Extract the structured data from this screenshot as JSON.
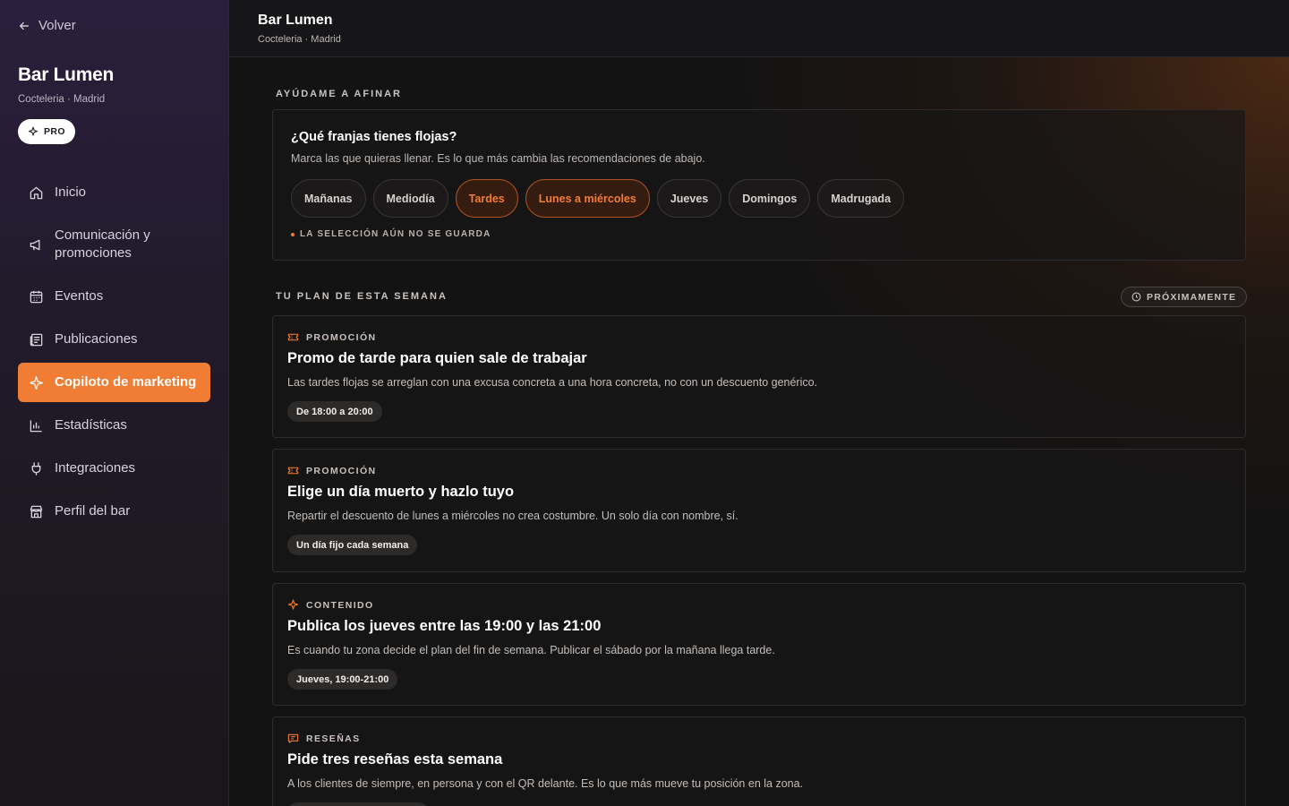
{
  "sidebar": {
    "back_label": "Volver",
    "bar_name": "Bar Lumen",
    "bar_subtitle": "Cocteleria · Madrid",
    "badge": "PRO",
    "items": [
      {
        "label": "Inicio",
        "icon": "home-icon"
      },
      {
        "label": "Comunicación y promociones",
        "icon": "megaphone-icon"
      },
      {
        "label": "Eventos",
        "icon": "calendar-icon"
      },
      {
        "label": "Publicaciones",
        "icon": "newspaper-icon"
      },
      {
        "label": "Copiloto de marketing",
        "icon": "sparkle-icon",
        "active": true
      },
      {
        "label": "Estadísticas",
        "icon": "bar-chart-icon"
      },
      {
        "label": "Integraciones",
        "icon": "plug-icon"
      },
      {
        "label": "Perfil del bar",
        "icon": "store-icon"
      }
    ]
  },
  "header": {
    "title": "Bar Lumen",
    "subtitle": "Cocteleria · Madrid"
  },
  "tune": {
    "section_label": "AYÚDAME A AFINAR",
    "question": "¿Qué franjas tienes flojas?",
    "description": "Marca las que quieras llenar. Es lo que más cambia las recomendaciones de abajo.",
    "chips": [
      {
        "label": "Mañanas",
        "selected": false
      },
      {
        "label": "Mediodía",
        "selected": false
      },
      {
        "label": "Tardes",
        "selected": true
      },
      {
        "label": "Lunes a miércoles",
        "selected": true
      },
      {
        "label": "Jueves",
        "selected": false
      },
      {
        "label": "Domingos",
        "selected": false
      },
      {
        "label": "Madrugada",
        "selected": false
      }
    ],
    "notice": "LA SELECCIÓN AÚN NO SE GUARDA"
  },
  "plan": {
    "section_label": "TU PLAN DE ESTA SEMANA",
    "soon_label": "PRÓXIMAMENTE",
    "cards": [
      {
        "category": "PROMOCIÓN",
        "icon": "ticket-icon",
        "title": "Promo de tarde para quien sale de trabajar",
        "description": "Las tardes flojas se arreglan con una excusa concreta a una hora concreta, no con un descuento genérico.",
        "tag": "De 18:00 a 20:00"
      },
      {
        "category": "PROMOCIÓN",
        "icon": "ticket-icon",
        "title": "Elige un día muerto y hazlo tuyo",
        "description": "Repartir el descuento de lunes a miércoles no crea costumbre. Un solo día con nombre, sí.",
        "tag": "Un día fijo cada semana"
      },
      {
        "category": "CONTENIDO",
        "icon": "sparkle-icon",
        "title": "Publica los jueves entre las 19:00 y las 21:00",
        "description": "Es cuando tu zona decide el plan del fin de semana. Publicar el sábado por la mañana llega tarde.",
        "tag": "Jueves, 19:00-21:00"
      },
      {
        "category": "RESEÑAS",
        "icon": "message-icon",
        "title": "Pide tres reseñas esta semana",
        "description": "A los clientes de siempre, en persona y con el QR delante. Es lo que más mueve tu posición en la zona.",
        "tag": ""
      }
    ]
  },
  "colors": {
    "accent": "#f07d33",
    "background": "#141212"
  }
}
